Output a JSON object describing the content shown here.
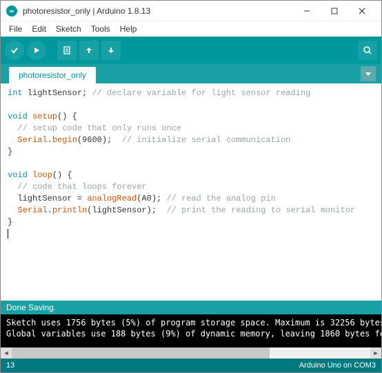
{
  "window": {
    "title": "photoresistor_only | Arduino 1.8.13"
  },
  "menu": {
    "file": "File",
    "edit": "Edit",
    "sketch": "Sketch",
    "tools": "Tools",
    "help": "Help"
  },
  "tabs": {
    "sketch_name": "photoresistor_only"
  },
  "code": {
    "l1_kw1": "int",
    "l1_id": " lightSensor; ",
    "l1_cm": "// declare variable for light sensor reading",
    "l3_kw": "void",
    "l3_fn": "setup",
    "l3_rest": "() {",
    "l4_cm": "  // setup code that only runs once",
    "l5_lead": "  ",
    "l5_serial": "Serial",
    "l5_dot": ".",
    "l5_begin": "begin",
    "l5_args": "(9600);  ",
    "l5_cm": "// initialize serial communication",
    "l6": "}",
    "l8_kw": "void",
    "l8_fn": "loop",
    "l8_rest": "() {",
    "l9_cm": "  // code that loops forever",
    "l10_lead": "  lightSensor = ",
    "l10_fn": "analogRead",
    "l10_args": "(A0); ",
    "l10_cm": "// read the analog pin",
    "l11_lead": "  ",
    "l11_serial": "Serial",
    "l11_dot": ".",
    "l11_fn": "println",
    "l11_args": "(lightSensor);  ",
    "l11_cm": "// print the reading to serial monitor",
    "l12": "}"
  },
  "status": {
    "message": "Done Saving."
  },
  "console": {
    "line1": "Sketch uses 1756 bytes (5%) of program storage space. Maximum is 32256 bytes",
    "line2": "Global variables use 188 bytes (9%) of dynamic memory, leaving 1860 bytes fo"
  },
  "footer": {
    "line_no": "13",
    "board": "Arduino Uno on COM3"
  }
}
